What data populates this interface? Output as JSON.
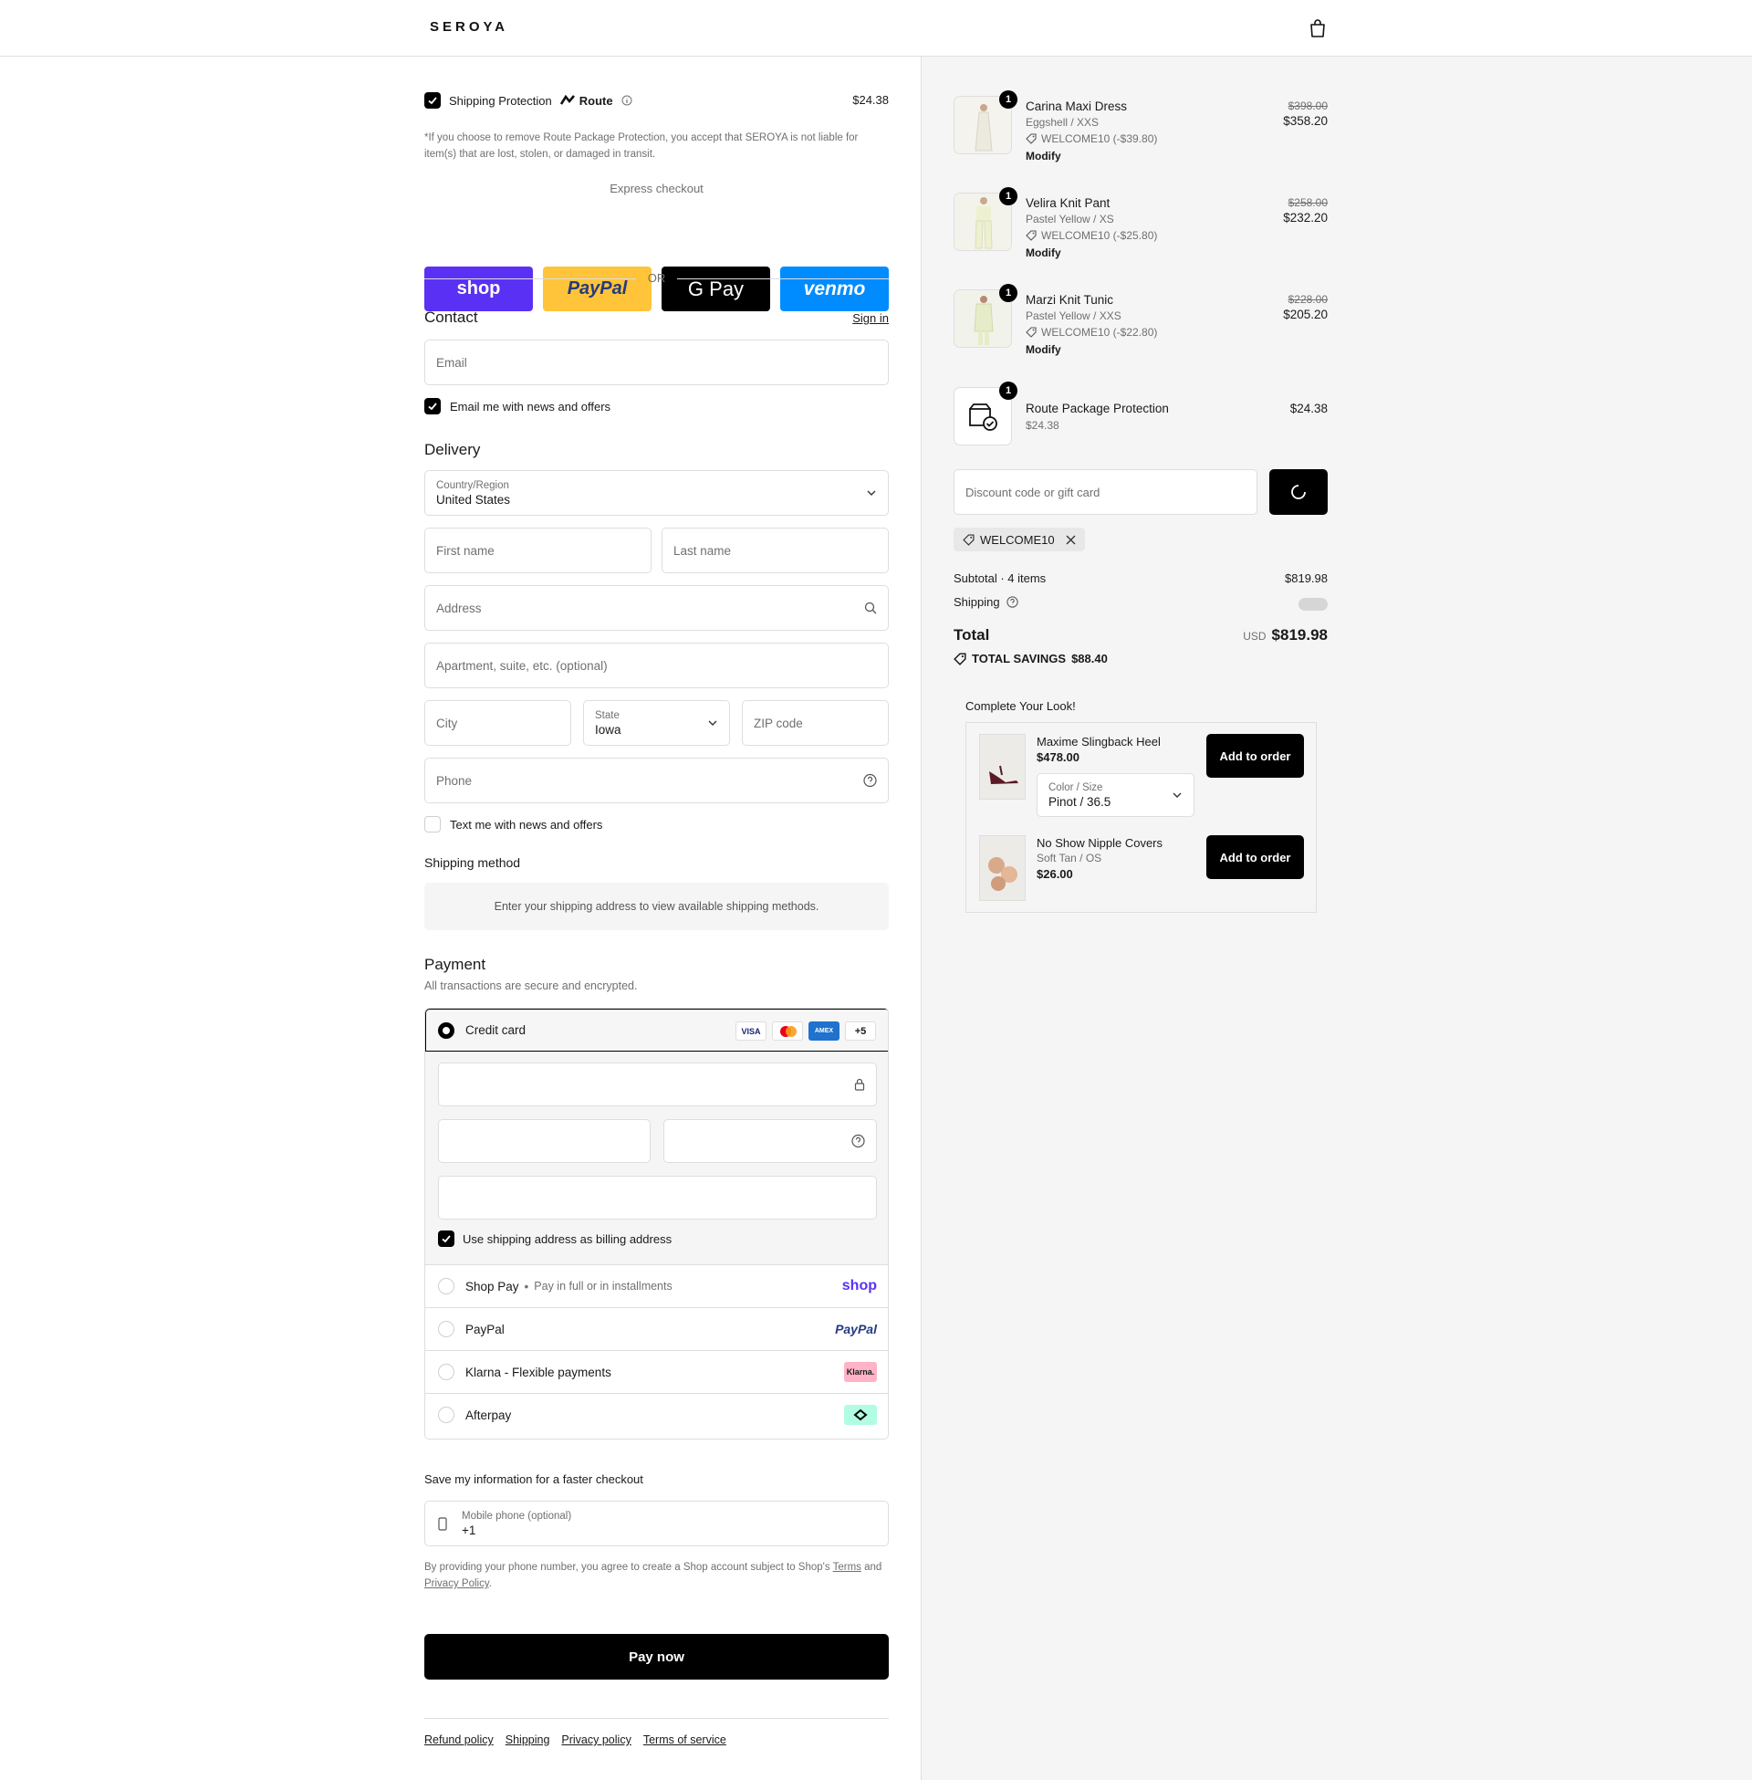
{
  "header": {
    "logo": "SEROYA",
    "cart_icon": "shopping-bag-icon"
  },
  "protection": {
    "label": "Shipping Protection",
    "brand": "Route",
    "price": "$24.38",
    "note": "*If you choose to remove Route Package Protection, you accept that SEROYA is not liable for item(s) that are lost, stolen, or damaged in transit."
  },
  "express": {
    "title": "Express checkout",
    "buttons": [
      {
        "label": "shop",
        "color": "#5a31f4"
      },
      {
        "label": "PayPal",
        "color": "#ffc439"
      },
      {
        "label": "G Pay",
        "color": "#000000"
      },
      {
        "label": "venmo",
        "color": "#008cff"
      }
    ],
    "or": "OR"
  },
  "contact": {
    "title": "Contact",
    "sign_in": "Sign in",
    "email_placeholder": "Email",
    "news_label": "Email me with news and offers"
  },
  "delivery": {
    "title": "Delivery",
    "country_label": "Country/Region",
    "country_value": "United States",
    "first_name": "First name",
    "last_name": "Last name",
    "address": "Address",
    "apartment": "Apartment, suite, etc. (optional)",
    "city": "City",
    "state_label": "State",
    "state_value": "Iowa",
    "zip": "ZIP code",
    "phone": "Phone",
    "text_label": "Text me with news and offers"
  },
  "shipping_method": {
    "title": "Shipping method",
    "message": "Enter your shipping address to view available shipping methods."
  },
  "payment": {
    "title": "Payment",
    "subtitle": "All transactions are secure and encrypted.",
    "credit_card": "Credit card",
    "card_more": "+5",
    "billing_label": "Use shipping address as billing address",
    "options": [
      {
        "label": "Shop Pay",
        "sub": "Pay in full or in installments",
        "logo": "shop"
      },
      {
        "label": "PayPal",
        "sub": "",
        "logo": "PayPal"
      },
      {
        "label": "Klarna - Flexible payments",
        "sub": "",
        "logo": "Klarna."
      },
      {
        "label": "Afterpay",
        "sub": "",
        "logo": "afterpay-icon"
      }
    ]
  },
  "save_info": {
    "title": "Save my information for a faster checkout",
    "phone_label": "Mobile phone (optional)",
    "phone_value": "+1",
    "legal_prefix": "By providing your phone number, you agree to create a Shop account subject to Shop's",
    "terms": "Terms",
    "and": "and",
    "privacy": "Privacy Policy",
    "period": "."
  },
  "pay_now": "Pay now",
  "footer_links": [
    "Refund policy",
    "Shipping",
    "Privacy policy",
    "Terms of service"
  ],
  "cart": {
    "items": [
      {
        "qty": "1",
        "name": "Carina Maxi Dress",
        "variant": "Eggshell / XXS",
        "discount": "WELCOME10 (-$39.80)",
        "modify": "Modify",
        "old": "$398.00",
        "price": "$358.20",
        "swatch": "#ece9de"
      },
      {
        "qty": "1",
        "name": "Velira Knit Pant",
        "variant": "Pastel Yellow / XS",
        "discount": "WELCOME10 (-$25.80)",
        "modify": "Modify",
        "old": "$258.00",
        "price": "$232.20",
        "swatch": "#eef0d2"
      },
      {
        "qty": "1",
        "name": "Marzi Knit Tunic",
        "variant": "Pastel Yellow / XXS",
        "discount": "WELCOME10 (-$22.80)",
        "modify": "Modify",
        "old": "$228.00",
        "price": "$205.20",
        "swatch": "#e7ecc8"
      }
    ],
    "route": {
      "qty": "1",
      "name": "Route Package Protection",
      "sub": "$24.38",
      "price": "$24.38"
    },
    "discount_placeholder": "Discount code or gift card",
    "applied_code": "WELCOME10",
    "subtotal_label": "Subtotal · 4 items",
    "subtotal_value": "$819.98",
    "shipping_label": "Shipping",
    "total_label": "Total",
    "currency": "USD",
    "total_value": "$819.98",
    "savings_label": "TOTAL SAVINGS",
    "savings_value": "$88.40"
  },
  "upsell": {
    "title": "Complete Your Look!",
    "items": [
      {
        "name": "Maxime Slingback Heel",
        "price": "$478.00",
        "select_label": "Color / Size",
        "select_value": "Pinot / 36.5",
        "button": "Add to order"
      },
      {
        "name": "No Show Nipple Covers",
        "variant": "Soft Tan / OS",
        "price": "$26.00",
        "button": "Add to order"
      }
    ]
  }
}
